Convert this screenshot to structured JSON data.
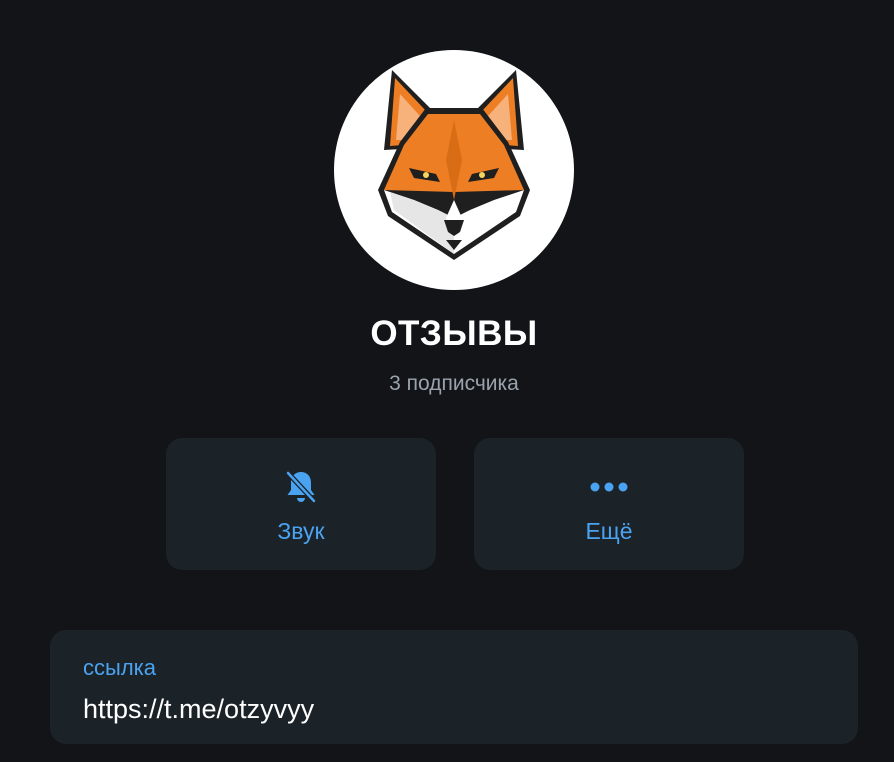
{
  "channel": {
    "title": "ОТЗЫВЫ",
    "subscribers": "3 подписчика",
    "avatar_icon": "fox-logo-icon"
  },
  "actions": [
    {
      "label": "Звук",
      "icon": "bell-off-icon"
    },
    {
      "label": "Ещё",
      "icon": "more-dots-icon"
    }
  ],
  "info": {
    "link_label": "ссылка",
    "link_value": "https://t.me/otzyvyy"
  },
  "colors": {
    "background": "#121417",
    "card": "#1b2228",
    "accent": "#4aa3f0",
    "muted_text": "#9aa3ad",
    "fox_orange": "#ee7e23"
  }
}
